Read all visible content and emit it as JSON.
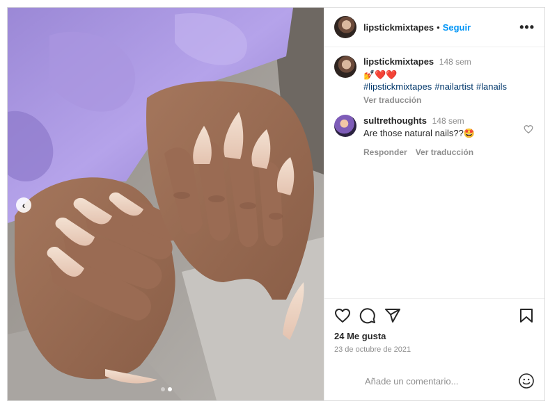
{
  "post": {
    "username": "lipstickmixtapes",
    "separator": "•",
    "follow_label": "Seguir",
    "more_label": "•••",
    "prev_label": "‹"
  },
  "caption": {
    "username": "lipstickmixtapes",
    "time": "148 sem",
    "emoji": "💅❤️❤️",
    "hashtags": [
      "#lipstickmixtapes",
      "#nailartist",
      "#lanails"
    ],
    "translate_label": "Ver traducción"
  },
  "comments": [
    {
      "username": "sultrethoughts",
      "time": "148 sem",
      "text": "Are those natural nails??🤩",
      "reply_label": "Responder",
      "translate_label": "Ver traducción"
    }
  ],
  "likes": {
    "text": "24 Me gusta"
  },
  "date": {
    "text": "23 de octubre de 2021"
  },
  "add_comment": {
    "placeholder": "Añade un comentario..."
  },
  "carousel": {
    "count": 2,
    "active_index": 1
  },
  "icons": {
    "like": "heart-icon",
    "comment": "comment-icon",
    "share": "paper-plane-icon",
    "save": "bookmark-icon",
    "emoji": "smiley-icon",
    "prev": "chevron-left-icon"
  },
  "colors": {
    "link": "#0095f6",
    "hashtag": "#00376b",
    "muted": "#8e8e8e",
    "text": "#262626"
  }
}
